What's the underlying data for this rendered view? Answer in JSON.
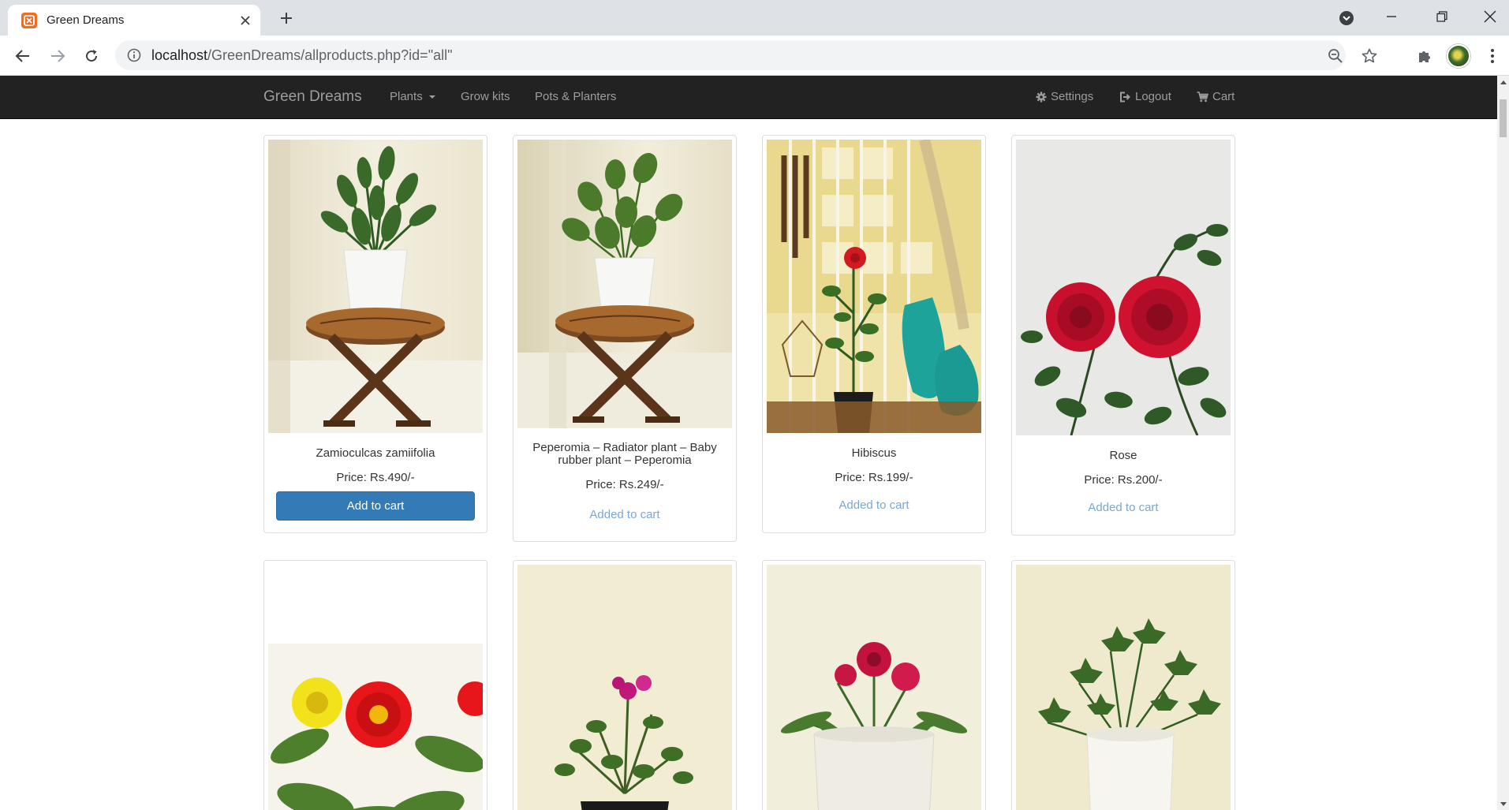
{
  "browser": {
    "tab": {
      "title": "Green Dreams"
    },
    "url": {
      "host": "localhost",
      "path": "/GreenDreams/allproducts.php?id=\"all\""
    }
  },
  "site": {
    "brand": "Green Dreams",
    "nav_left": [
      {
        "label": "Plants",
        "dropdown": true
      },
      {
        "label": "Grow kits",
        "dropdown": false
      },
      {
        "label": "Pots & Planters",
        "dropdown": false
      }
    ],
    "nav_right": [
      {
        "label": "Settings",
        "icon": "gear-icon"
      },
      {
        "label": "Logout",
        "icon": "logout-icon"
      },
      {
        "label": "Cart",
        "icon": "cart-icon"
      }
    ]
  },
  "products": [
    {
      "name": "Zamioculcas zamiifolia",
      "price": "Price: Rs.490/-",
      "action": "Add to cart",
      "in_cart": false,
      "image": "zz-plant-on-wooden-stool"
    },
    {
      "name": "Peperomia – Radiator plant – Baby rubber plant – Peperomia",
      "price": "Price: Rs.249/-",
      "action": "Added to cart",
      "in_cart": true,
      "image": "peperomia-on-wooden-stool"
    },
    {
      "name": "Hibiscus",
      "price": "Price: Rs.199/-",
      "action": "Added to cart",
      "in_cart": true,
      "image": "hibiscus-by-window"
    },
    {
      "name": "Rose",
      "price": "Price: Rs.200/-",
      "action": "Added to cart",
      "in_cart": true,
      "image": "red-roses"
    },
    {
      "image": "zinnia-flowers"
    },
    {
      "image": "bougainvillea-in-black-pot"
    },
    {
      "image": "dianthus-in-white-pot"
    },
    {
      "image": "ivy-in-white-pot"
    }
  ],
  "colors": {
    "navbar": "#222222",
    "primary_button": "#337ab7",
    "added_link": "#7aa7d6"
  }
}
